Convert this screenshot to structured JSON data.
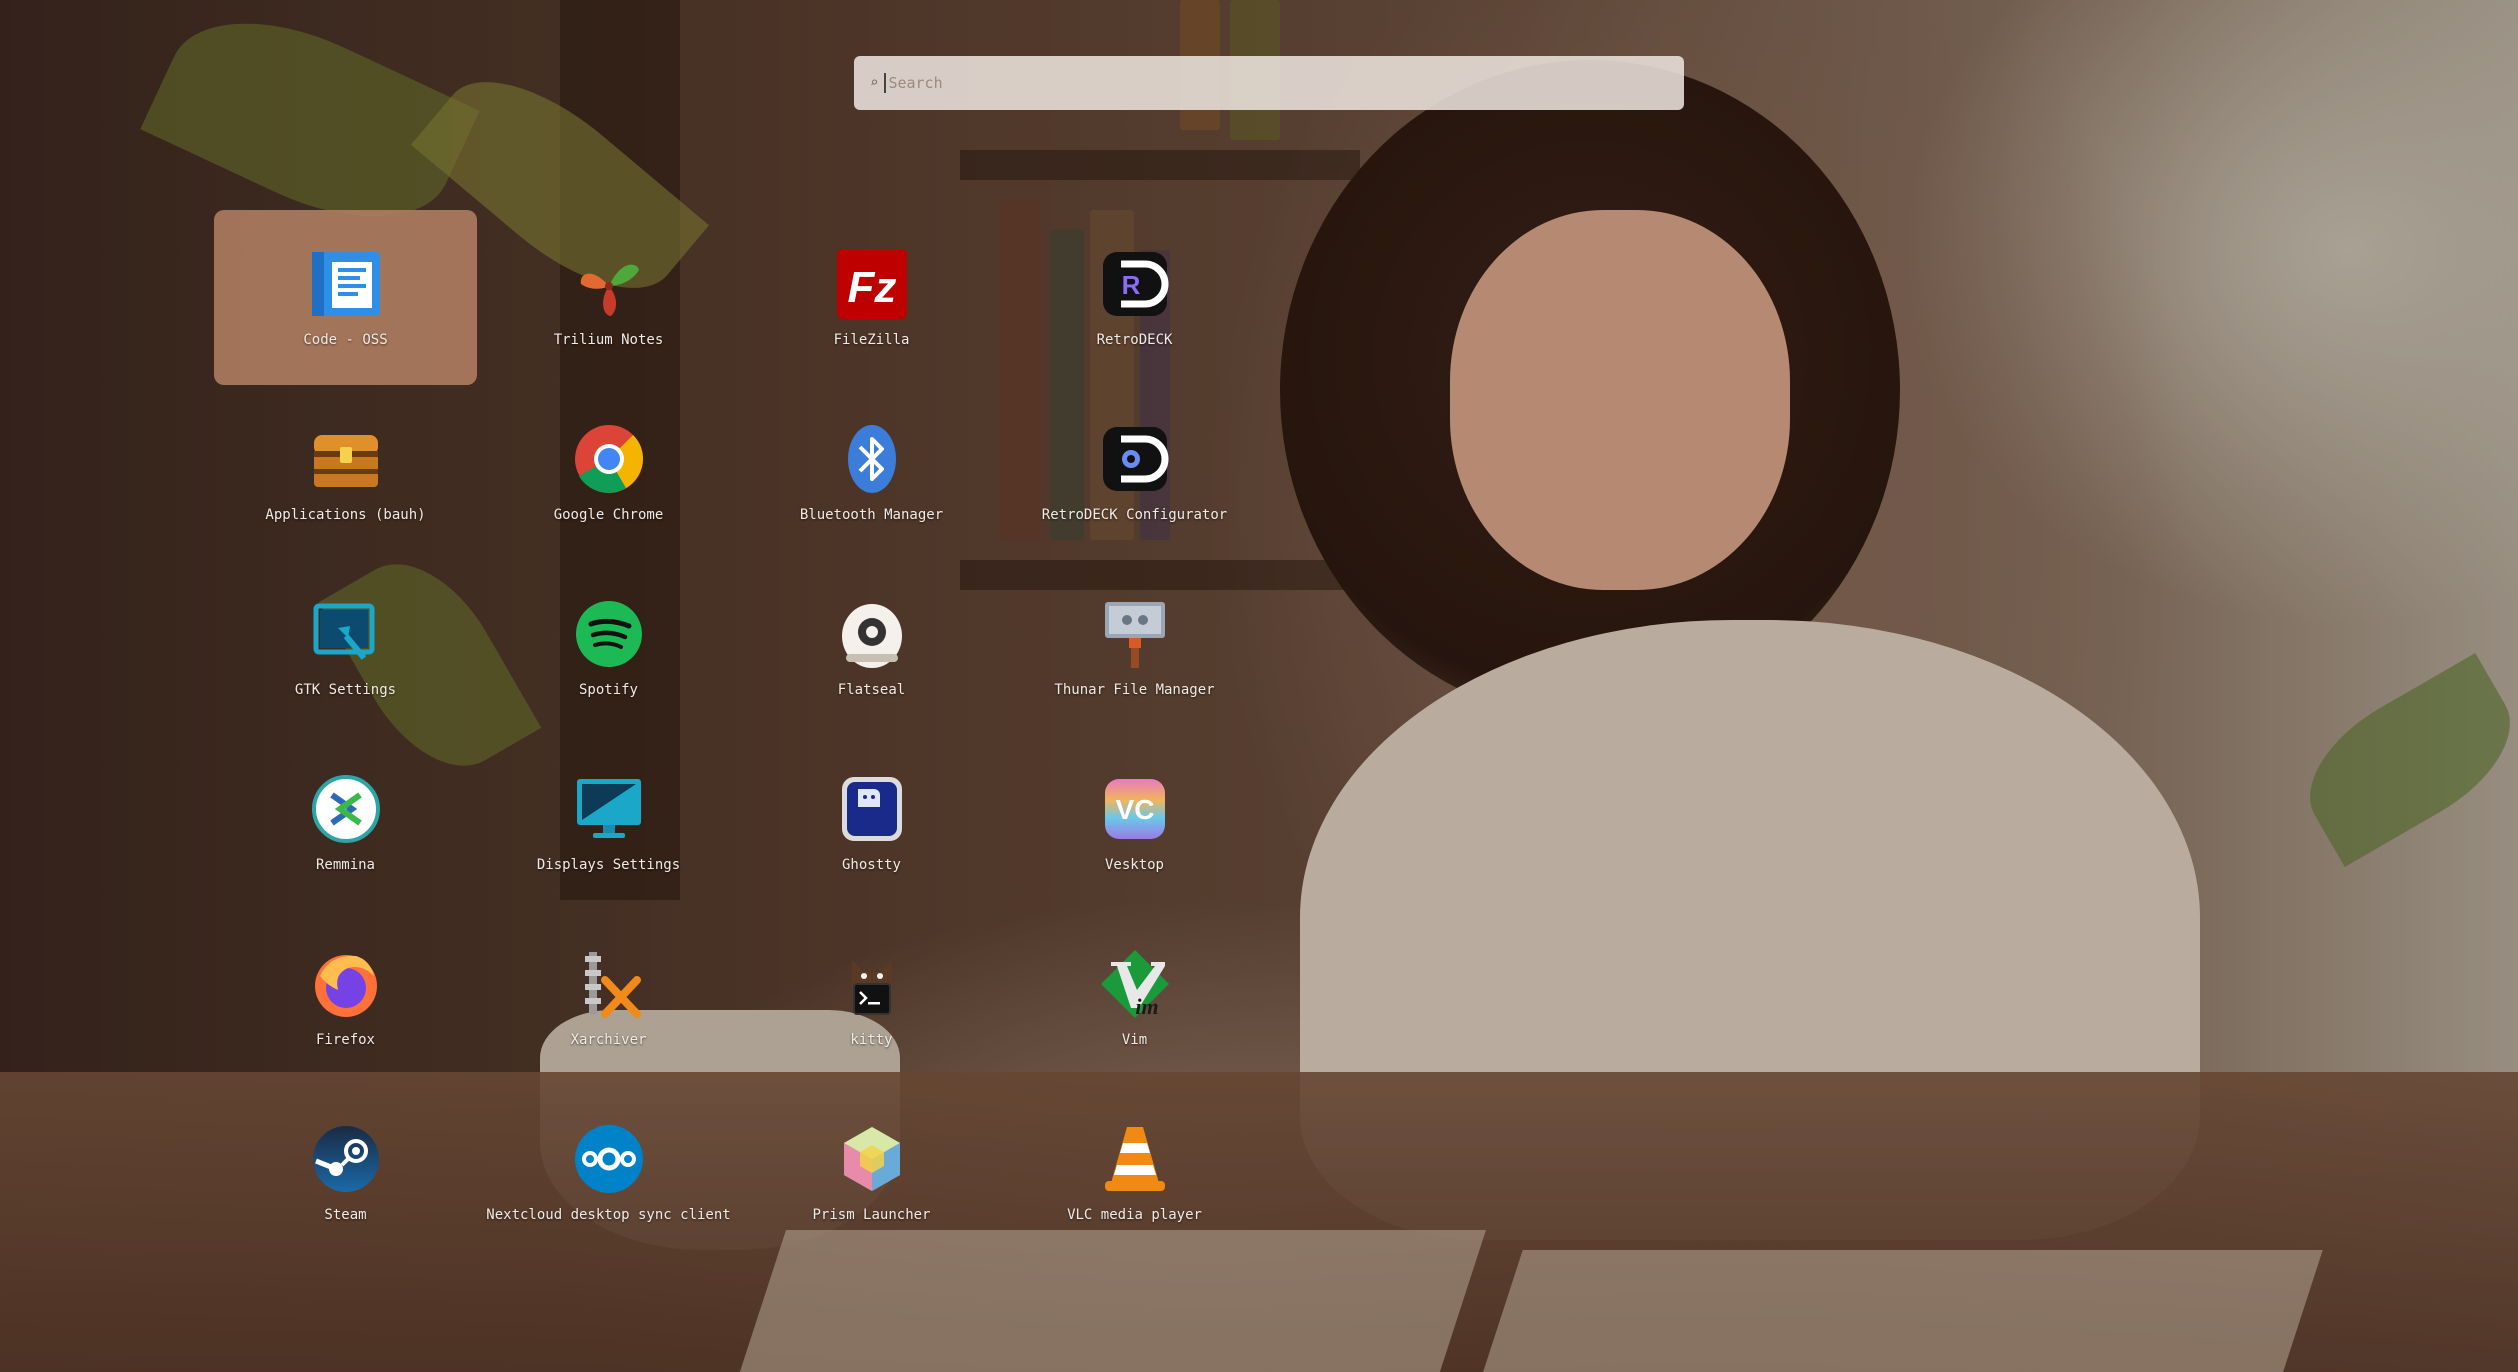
{
  "search": {
    "placeholder": "Search",
    "icon": "search-icon"
  },
  "apps": [
    {
      "name": "Code - OSS",
      "icon": "code-oss-icon",
      "selected": true
    },
    {
      "name": "Trilium Notes",
      "icon": "trilium-icon"
    },
    {
      "name": "FileZilla",
      "icon": "filezilla-icon"
    },
    {
      "name": "RetroDECK",
      "icon": "retrodeck-icon"
    },
    {
      "name": "Applications (bauh)",
      "icon": "bauh-icon"
    },
    {
      "name": "Google Chrome",
      "icon": "chrome-icon"
    },
    {
      "name": "Bluetooth Manager",
      "icon": "bluetooth-icon"
    },
    {
      "name": "RetroDECK Configurator",
      "icon": "retrodeck-configurator-icon"
    },
    {
      "name": "GTK Settings",
      "icon": "gtk-settings-icon"
    },
    {
      "name": "Spotify",
      "icon": "spotify-icon"
    },
    {
      "name": "Flatseal",
      "icon": "flatseal-icon"
    },
    {
      "name": "Thunar File Manager",
      "icon": "thunar-icon"
    },
    {
      "name": "Remmina",
      "icon": "remmina-icon"
    },
    {
      "name": "Displays Settings",
      "icon": "displays-icon"
    },
    {
      "name": "Ghostty",
      "icon": "ghostty-icon"
    },
    {
      "name": "Vesktop",
      "icon": "vesktop-icon"
    },
    {
      "name": "Firefox",
      "icon": "firefox-icon"
    },
    {
      "name": "Xarchiver",
      "icon": "xarchiver-icon"
    },
    {
      "name": "kitty",
      "icon": "kitty-icon"
    },
    {
      "name": "Vim",
      "icon": "vim-icon"
    },
    {
      "name": "Steam",
      "icon": "steam-icon"
    },
    {
      "name": "Nextcloud desktop sync client",
      "icon": "nextcloud-icon"
    },
    {
      "name": "Prism Launcher",
      "icon": "prism-launcher-icon"
    },
    {
      "name": "VLC media player",
      "icon": "vlc-icon"
    }
  ],
  "colors": {
    "selected_bg": "#b07e62",
    "search_bg": "#ebe2dc",
    "label": "#f2ebe6"
  }
}
